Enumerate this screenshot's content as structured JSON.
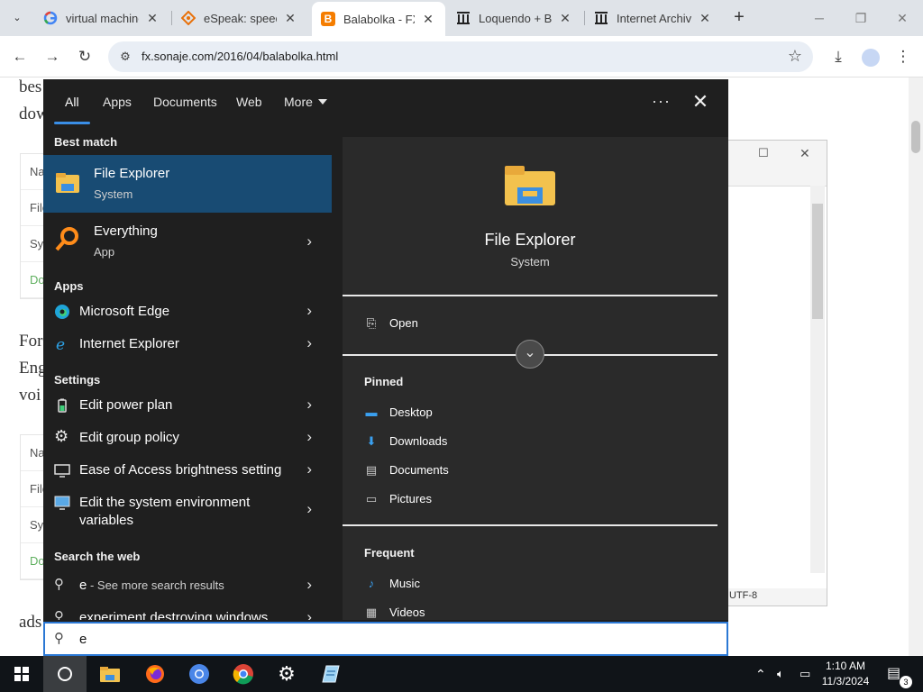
{
  "browser": {
    "tabs": [
      {
        "title": "virtual machine",
        "icon": "google-icon",
        "active": false
      },
      {
        "title": "eSpeak: speech",
        "icon": "espeak-icon",
        "active": false
      },
      {
        "title": "Balabolka - FX",
        "icon": "blogger-icon",
        "active": true
      },
      {
        "title": "Loquendo + Ba",
        "icon": "archive-icon",
        "active": false
      },
      {
        "title": "Internet Archive",
        "icon": "archive-icon",
        "active": false
      }
    ],
    "url": "fx.sonaje.com/2016/04/balabolka.html",
    "colors": {
      "tabbar": "#dfe3e8",
      "omnibox": "#e9eef5"
    }
  },
  "page": {
    "text_fragments": [
      "bes",
      "dow",
      "For",
      "Eng",
      "voi",
      "ads"
    ],
    "table1_rows": [
      "Na",
      "File",
      "Sys",
      "Do"
    ],
    "table2_rows": [
      "Na",
      "File",
      "Sys",
      "Do"
    ]
  },
  "dialog": {
    "encoding": "UTF-8"
  },
  "start_menu": {
    "tabs": [
      "All",
      "Apps",
      "Documents",
      "Web",
      "More"
    ],
    "active_tab": "All",
    "sections": {
      "best_match": "Best match",
      "apps": "Apps",
      "settings": "Settings",
      "search_web": "Search the web"
    },
    "best_match": {
      "label": "File Explorer",
      "sub": "System"
    },
    "everything": {
      "label": "Everything",
      "sub": "App"
    },
    "apps": [
      {
        "label": "Microsoft Edge",
        "icon": "edge-icon"
      },
      {
        "label": "Internet Explorer",
        "icon": "ie-icon"
      }
    ],
    "settings": [
      {
        "label": "Edit power plan",
        "icon": "battery-icon"
      },
      {
        "label": "Edit group policy",
        "icon": "gear-icon"
      },
      {
        "label": "Ease of Access brightness setting",
        "icon": "monitor-icon"
      },
      {
        "label": "Edit the system environment",
        "label2": "variables",
        "icon": "monitor-icon"
      }
    ],
    "web": [
      {
        "label": "e",
        "suffix": " - See more search results"
      },
      {
        "label": "experiment destroying windows"
      }
    ],
    "preview": {
      "title": "File Explorer",
      "sub": "System",
      "open": "Open",
      "pinned_header": "Pinned",
      "pinned": [
        "Desktop",
        "Downloads",
        "Documents",
        "Pictures"
      ],
      "frequent_header": "Frequent",
      "frequent": [
        "Music",
        "Videos"
      ]
    },
    "search_value": "e",
    "accent": "#2b78d4"
  },
  "taskbar": {
    "time": "1:10 AM",
    "date": "11/3/2024",
    "notifications": "3"
  }
}
